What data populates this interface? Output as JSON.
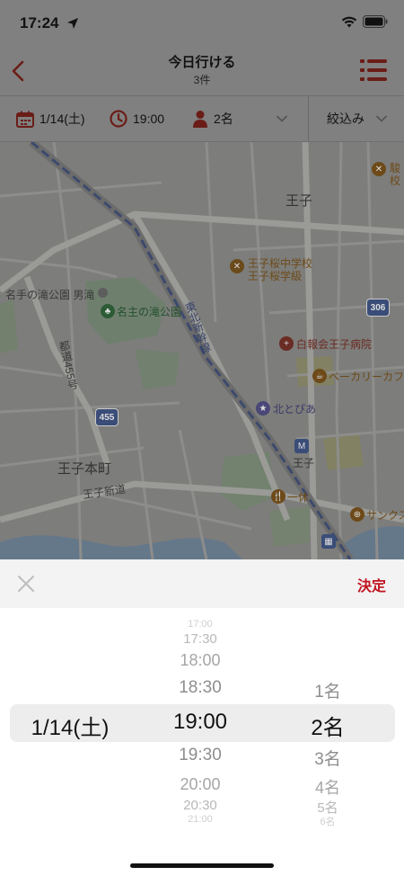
{
  "status_bar": {
    "time": "17:24"
  },
  "nav": {
    "title": "今日行ける",
    "subtitle": "3件"
  },
  "filter": {
    "date": "1/14(土)",
    "time": "19:00",
    "people": "2名",
    "refine_label": "絞込み"
  },
  "map": {
    "labels": {
      "oji_area": "王子",
      "oji_honcho": "王子本町",
      "oji_shindo": "王子新道",
      "school_1": "王子桜中学校",
      "school_2": "王子桜学級",
      "hospital": "白報会王子病院",
      "bakery": "ベーカリーカフ",
      "kita_tobia": "北とぴあ",
      "station": "王子",
      "park": "名主の滝公園",
      "park_gate": "名手の滝公園 男滝",
      "route_name": "都道455号",
      "shinkansen": "東北新幹線",
      "ikkyu": "一休",
      "sunkus": "サンクス",
      "top_right_1": "駿",
      "top_right_2": "校"
    },
    "route_shields": [
      "455",
      "306"
    ]
  },
  "picker": {
    "confirm_label": "決定",
    "date_selected": "1/14(土)",
    "time_items": [
      "17:00",
      "17:30",
      "18:00",
      "18:30",
      "19:00",
      "19:30",
      "20:00",
      "20:30",
      "21:00"
    ],
    "people_items": [
      "1名",
      "2名",
      "3名",
      "4名",
      "5名",
      "6名"
    ]
  },
  "colors": {
    "accent": "#c0141f",
    "dim_overlay": "#808080",
    "sheet_bg": "#ffffff"
  }
}
